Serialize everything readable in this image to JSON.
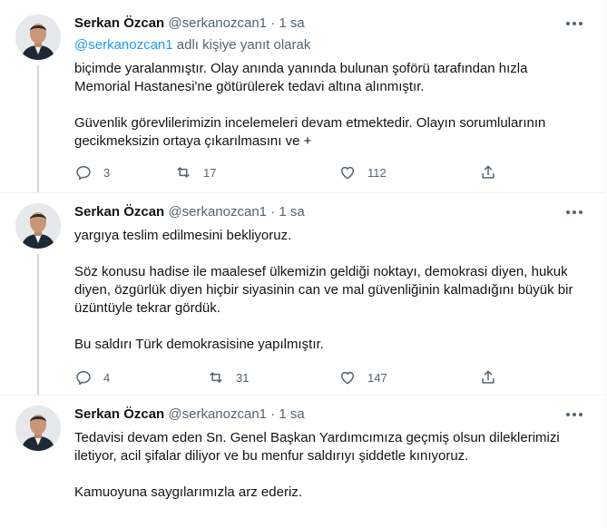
{
  "tweets": [
    {
      "name": "Serkan Özcan",
      "handle": "@serkanozcan1",
      "dot": "·",
      "time": "1 sa",
      "reply_handle": "@serkanozcan1",
      "reply_suffix": " adlı kişiye yanıt olarak",
      "paragraphs": [
        "biçimde yaralanmıştır. Olay anında yanında bulunan şoförü tarafından hızla Memorial Hastanesi'ne götürülerek tedavi altına alınmıştır.",
        "Güvenlik görevlilerimizin incelemeleri devam etmektedir. Olayın sorumlularının gecikmeksizin ortaya çıkarılmasını ve +"
      ],
      "replies": "3",
      "retweets": "17",
      "likes": "112"
    },
    {
      "name": "Serkan Özcan",
      "handle": "@serkanozcan1",
      "dot": "·",
      "time": "1 sa",
      "paragraphs": [
        "yargıya teslim edilmesini bekliyoruz.",
        "Söz konusu hadise ile maalesef ülkemizin geldiği noktayı, demokrasi diyen, hukuk diyen, özgürlük diyen hiçbir siyasinin can ve mal güvenliğinin kalmadığını büyük bir üzüntüyle tekrar gördük.",
        "Bu saldırı Türk demokrasisine yapılmıştır."
      ],
      "replies": "4",
      "retweets": "31",
      "likes": "147"
    },
    {
      "name": "Serkan Özcan",
      "handle": "@serkanozcan1",
      "dot": "·",
      "time": "1 sa",
      "paragraphs": [
        "Tedavisi devam eden Sn. Genel Başkan Yardımcımıza geçmiş olsun dileklerimizi iletiyor, acil şifalar diliyor ve bu menfur saldırıyı şiddetle kınıyoruz.",
        "Kamuoyuna saygılarımızla arz ederiz."
      ]
    }
  ],
  "icons": {
    "more": "more-icon",
    "reply": "reply-icon",
    "retweet": "retweet-icon",
    "like": "like-icon",
    "share": "share-icon"
  },
  "colors": {
    "link": "#1d9bf0",
    "secondary_text": "#536471",
    "thread_line": "#cfd9de",
    "border": "#eff3f4"
  }
}
